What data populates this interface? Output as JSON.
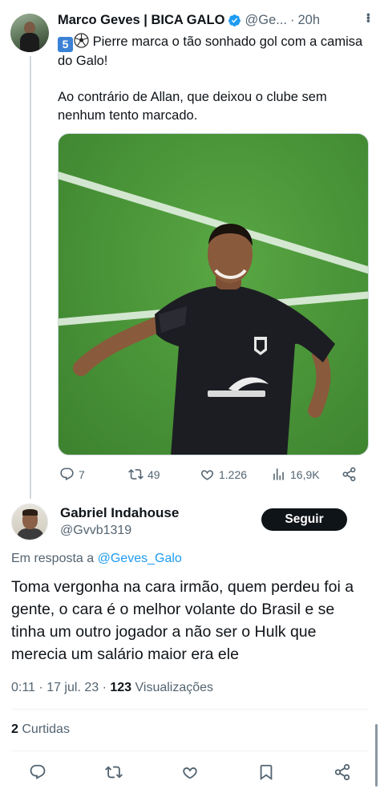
{
  "parent_tweet": {
    "author_name": "Marco Geves | BICA GALO",
    "author_handle": "@Ge...",
    "separator": "·",
    "time": "20h",
    "number_emoji": "5",
    "line1": "Pierre marca o tão sonhado gol com a camisa do Galo!",
    "line2": "Ao contrário de Allan, que deixou o clube sem nenhum tento marcado.",
    "stats": {
      "replies": "7",
      "retweets": "49",
      "likes": "1.226",
      "views": "16,9K"
    }
  },
  "reply": {
    "author_name": "Gabriel Indahouse",
    "author_handle": "@Gvvb1319",
    "follow_label": "Seguir",
    "in_reply_prefix": "Em resposta a",
    "in_reply_handle": "@Geves_Galo",
    "text": "Toma vergonha na cara irmão, quem perdeu foi a gente, o cara é o melhor volante do Brasil e se tinha um outro jogador a não ser o Hulk que merecia um salário maior era ele",
    "time": "0:11",
    "date": "17 jul. 23",
    "views_count": "123",
    "views_label": "Visualizações",
    "likes_count": "2",
    "likes_label": "Curtidas"
  },
  "colors": {
    "text": "#0f1419",
    "secondary": "#536471",
    "link": "#1d9bf0",
    "verified": "#1d9bf0",
    "follow_bg": "#0f1419"
  }
}
